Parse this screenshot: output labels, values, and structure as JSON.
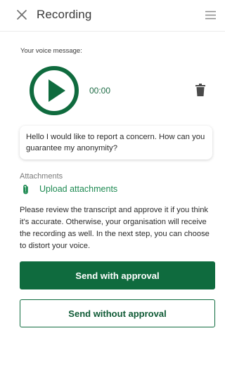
{
  "header": {
    "title": "Recording",
    "close_icon": "close-icon",
    "menu_icon": "hamburger-menu-icon"
  },
  "recording": {
    "label": "Your voice message:",
    "timer": "00:00",
    "play_icon": "play-icon",
    "delete_icon": "trash-icon"
  },
  "transcript": {
    "text": "Hello I would like to report a concern. How can you guarantee my anonymity?"
  },
  "attachments": {
    "label": "Attachments",
    "upload_label": "Upload attachments",
    "icon": "paperclip-icon"
  },
  "info_text": "Please review the transcript and approve it if you think it's accurate. Otherwise, your organisation will receive the recording as well. In the next step, you can choose to distort your voice.",
  "actions": {
    "send_with_approval": "Send with approval",
    "send_without_approval": "Send without approval"
  },
  "colors": {
    "brand_green": "#0f6b3e",
    "link_green": "#1e8a52",
    "text": "#2b2b2b"
  }
}
